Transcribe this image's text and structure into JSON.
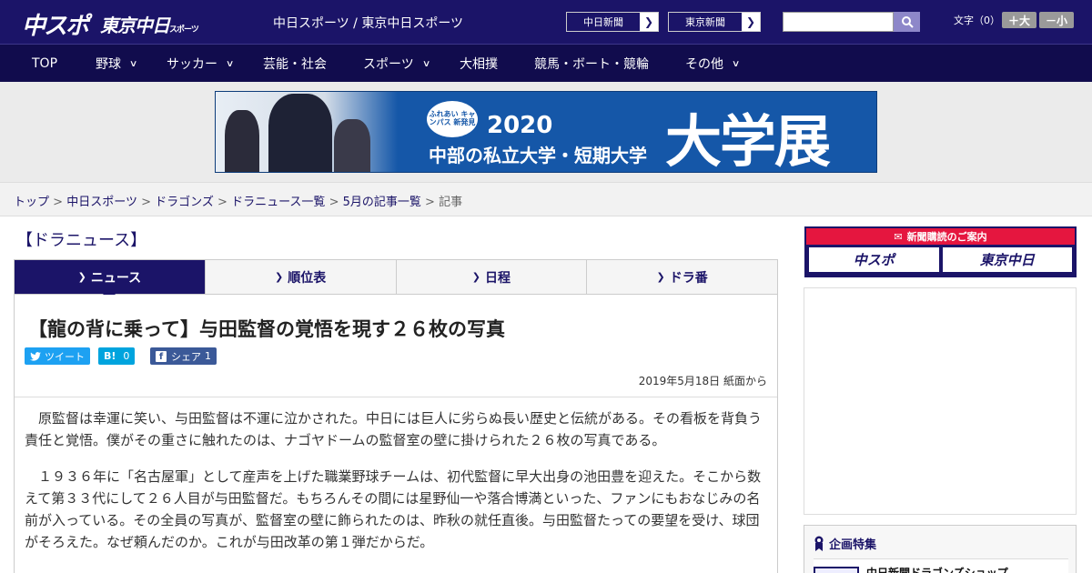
{
  "header": {
    "logo_chuspo": "中スポ",
    "logo_tokyo": "東京中日",
    "logo_tokyo_small": "スポーツ",
    "site_caption": "中日スポーツ / 東京中日スポーツ",
    "paper_links": [
      {
        "label": "中日新聞"
      },
      {
        "label": "東京新聞"
      }
    ],
    "search_placeholder": "",
    "font_size_label": "文字（0）",
    "font_plus": "＋大",
    "font_minus": "－小"
  },
  "nav": [
    {
      "label": "TOP",
      "dropdown": false
    },
    {
      "label": "野球",
      "dropdown": true
    },
    {
      "label": "サッカー",
      "dropdown": true
    },
    {
      "label": "芸能・社会",
      "dropdown": false
    },
    {
      "label": "スポーツ",
      "dropdown": true
    },
    {
      "label": "大相撲",
      "dropdown": false
    },
    {
      "label": "競馬・ボート・競輪",
      "dropdown": false
    },
    {
      "label": "その他",
      "dropdown": true
    }
  ],
  "banner": {
    "badge": "ふれあい キャンパス 新発見",
    "year": "2020",
    "subtitle": "中部の私立大学・短期大学",
    "big": "大学展"
  },
  "breadcrumb": {
    "items": [
      "トップ",
      "中日スポーツ",
      "ドラゴンズ",
      "ドラニュース一覧",
      "5月の記事一覧"
    ],
    "separator": ">",
    "current": "記事"
  },
  "section_title": "【ドラニュース】",
  "tabs": [
    {
      "label": "ニュース",
      "active": true
    },
    {
      "label": "順位表",
      "active": false
    },
    {
      "label": "日程",
      "active": false
    },
    {
      "label": "ドラ番",
      "active": false
    }
  ],
  "article": {
    "headline": "【龍の背に乗って】与田監督の覚悟を現す２６枚の写真",
    "share": {
      "tweet": "ツイート",
      "hatena_icon": "B!",
      "hatena_count": "0",
      "fb_label": "シェア",
      "fb_count": "1"
    },
    "date": "2019年5月18日 紙面から",
    "paragraphs": [
      "原監督は幸運に笑い、与田監督は不運に泣かされた。中日には巨人に劣らぬ長い歴史と伝統がある。その看板を背負う責任と覚悟。僕がその重さに触れたのは、ナゴヤドームの監督室の壁に掛けられた２６枚の写真である。",
      "１９３６年に「名古屋軍」として産声を上げた職業野球チームは、初代監督に早大出身の池田豊を迎えた。そこから数えて第３３代にして２６人目が与田監督だ。もちろんその間には星野仙一や落合博満といった、ファンにもおなじみの名前が入っている。その全員の写真が、監督室の壁に飾られたのは、昨秋の就任直後。与田監督たっての要望を受け、球団がそろえた。なぜ頼んだのか。これが与田改革の第１弾だからだ。"
    ]
  },
  "sidebar": {
    "subscribe_head": "新聞購読のご案内",
    "sub_logos": [
      "中スポ",
      "東京中日"
    ],
    "feature_title": "企画特集",
    "feature_item": "中日新聞ドラゴンズショップ"
  },
  "colors": {
    "brand_navy": "#1b1468",
    "nav_dark": "#110c4d",
    "twitter": "#1da1f2",
    "hatena": "#00a4de",
    "facebook": "#3b5998",
    "subscribe_red": "#e5163f"
  }
}
